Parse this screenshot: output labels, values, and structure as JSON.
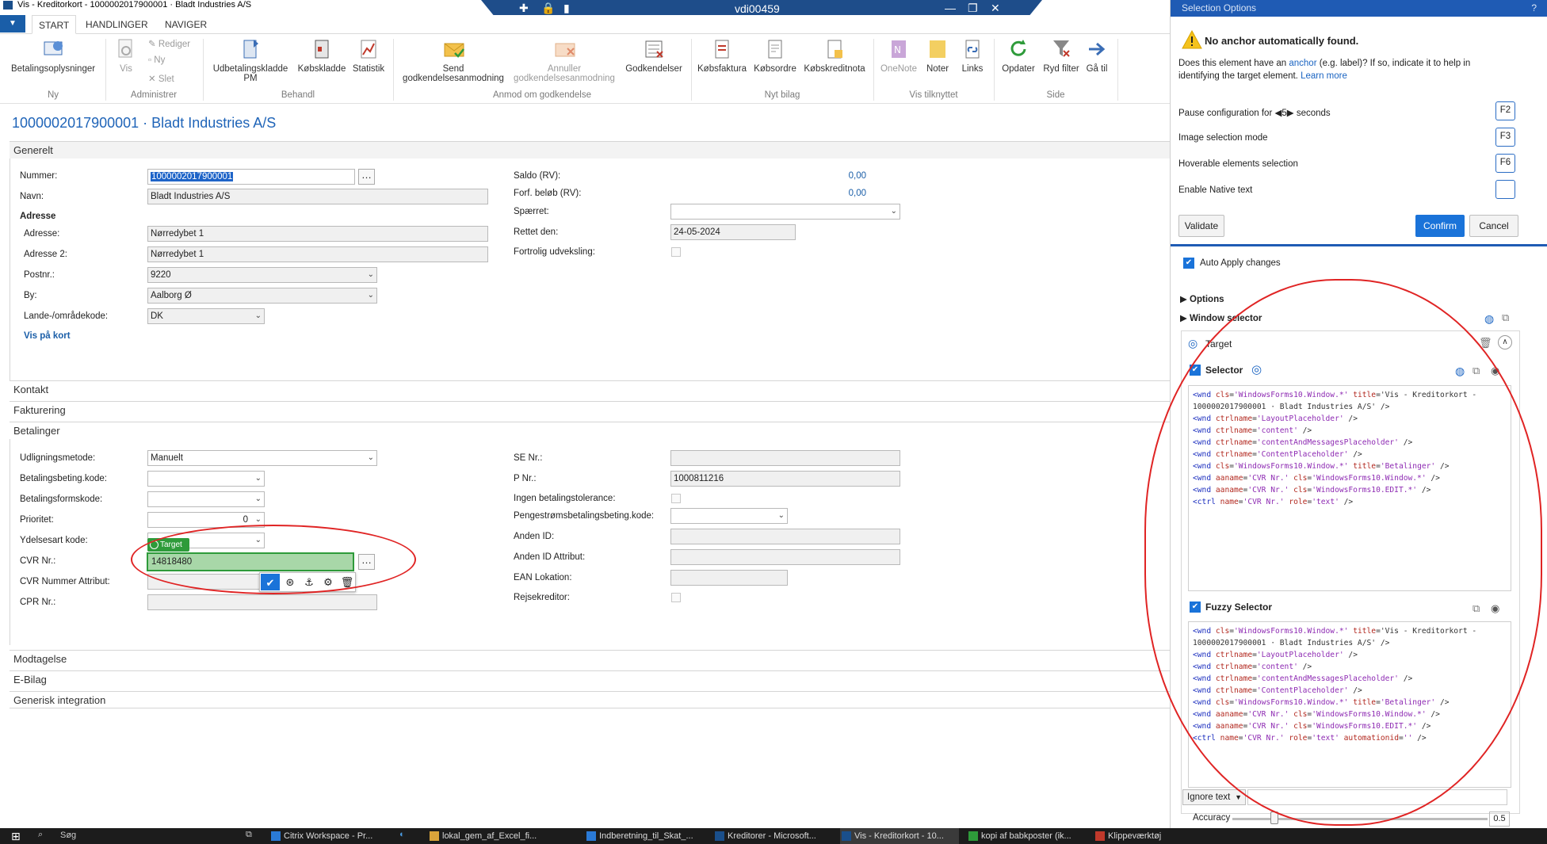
{
  "window": {
    "title": "Vis - Kreditorkort - 1000002017900001 · Bladt Industries A/S",
    "citrix_host": "vdi00459"
  },
  "ribbon_tabs": [
    {
      "label": "START"
    },
    {
      "label": "HANDLINGER"
    },
    {
      "label": "NAVIGER"
    }
  ],
  "ribbon": {
    "betalingsoplysninger": "Betalingsoplysninger",
    "vis": "Vis",
    "rediger": "Rediger",
    "ny": "Ny",
    "slet": "Slet",
    "udbetalingskladde_pm": "Udbetalingskladde PM",
    "kobskladde": "Købskladde",
    "statistik": "Statistik",
    "send_godkendelsesanmodning": "Send godkendelsesanmodning",
    "annuller_godkendelsesanmodning": "Annuller godkendelsesanmodning",
    "godkendelser": "Godkendelser",
    "kobsfaktura": "Købsfaktura",
    "kobsordre": "Købsordre",
    "kobskreditnota": "Købskreditnota",
    "onenote": "OneNote",
    "noter": "Noter",
    "links": "Links",
    "opdater": "Opdater",
    "ryd_filter": "Ryd filter",
    "ga_til": "Gå til",
    "groups": {
      "ny": "Ny",
      "administrer": "Administrer",
      "behandl": "Behandl",
      "anmod": "Anmod om godkendelse",
      "nyt_bilag": "Nyt bilag",
      "vis_tilknyttet": "Vis tilknyttet",
      "side": "Side"
    }
  },
  "page_title": "1000002017900001 · Bladt Industries A/S",
  "generelt": {
    "header": "Generelt",
    "nummer_label": "Nummer:",
    "nummer_value": "1000002017900001",
    "navn_label": "Navn:",
    "navn_value": "Bladt Industries A/S",
    "adresse_heading": "Adresse",
    "adresse_label": "Adresse:",
    "adresse_value": "Nørredybet 1",
    "adresse2_label": "Adresse 2:",
    "adresse2_value": "Nørredybet 1",
    "postnr_label": "Postnr.:",
    "postnr_value": "9220",
    "by_label": "By:",
    "by_value": "Aalborg Ø",
    "lande_label": "Lande-/områdekode:",
    "lande_value": "DK",
    "vis_paa_kort": "Vis på kort",
    "saldo_label": "Saldo (RV):",
    "saldo_value": "0,00",
    "forf_label": "Forf. beløb (RV):",
    "forf_value": "0,00",
    "spaerret_label": "Spærret:",
    "rettet_label": "Rettet den:",
    "rettet_value": "24-05-2024",
    "fortrolig_label": "Fortrolig udveksling:"
  },
  "collapsed_tabs": {
    "kontakt": "Kontakt",
    "fakturering": "Fakturering",
    "modtagelse": "Modtagelse",
    "ebilag": "E-Bilag",
    "generisk": "Generisk integration"
  },
  "betalinger": {
    "header": "Betalinger",
    "udligning_label": "Udligningsmetode:",
    "udligning_value": "Manuelt",
    "betingelse_label": "Betalingsbeting.kode:",
    "formkode_label": "Betalingsformskode:",
    "prioritet_label": "Prioritet:",
    "prioritet_value": "0",
    "ydelsesart_label": "Ydelsesart kode:",
    "cvr_label": "CVR Nr.:",
    "cvr_value": "14818480",
    "cvr_attr_label": "CVR Nummer Attribut:",
    "cpr_label": "CPR Nr.:",
    "se_label": "SE Nr.:",
    "p_label": "P Nr.:",
    "p_value": "1000811216",
    "ingen_label": "Ingen betalingstolerance:",
    "pengestrom_label": "Pengestrømsbetalingsbeting.kode:",
    "anden_id_label": "Anden ID:",
    "anden_id_attr_label": "Anden ID Attribut:",
    "ean_label": "EAN Lokation:",
    "rejse_label": "Rejsekreditor:"
  },
  "target_overlay": {
    "badge": "Target"
  },
  "selection_panel": {
    "title": "Selection Options",
    "help": "?",
    "warning_title": "No anchor automatically found.",
    "warning_body_1": "Does this element have an",
    "warning_link": "anchor",
    "warning_body_2": "(e.g. label)? If so, indicate it to help in",
    "warning_body_3": "identifying the target element.",
    "learn_more": "Learn more",
    "pause_label_1": "Pause configuration for",
    "pause_value": "5",
    "pause_label_2": "seconds",
    "pause_key": "F2",
    "image_mode": "Image selection mode",
    "image_key": "F3",
    "hoverable": "Hoverable elements selection",
    "hoverable_key": "F6",
    "native_text": "Enable Native text",
    "validate": "Validate",
    "confirm": "Confirm",
    "cancel": "Cancel",
    "auto_apply": "Auto Apply changes",
    "options": "Options",
    "window_selector": "Window selector",
    "target": "Target",
    "selector": "Selector",
    "fuzzy_selector": "Fuzzy Selector",
    "ignore_text": "Ignore text",
    "accuracy_label": "Accuracy",
    "accuracy_value": "0.5",
    "selector_lines": [
      "<wnd cls='WindowsForms10.Window.*' title='Vis - Kreditorkort -",
      "1000002017900001 · Bladt Industries A/S' />",
      "<wnd ctrlname='LayoutPlaceholder' />",
      "<wnd ctrlname='content' />",
      "<wnd ctrlname='contentAndMessagesPlaceholder' />",
      "<wnd ctrlname='ContentPlaceholder' />",
      "<wnd cls='WindowsForms10.Window.*' title='Betalinger' />",
      "<wnd aaname='CVR Nr.' cls='WindowsForms10.Window.*' />",
      "<wnd aaname='CVR Nr.' cls='WindowsForms10.EDIT.*' />",
      "<ctrl name='CVR Nr.' role='text' />"
    ],
    "fuzzy_lines": [
      "<wnd cls='WindowsForms10.Window.*' title='Vis - Kreditorkort -",
      "1000002017900001 · Bladt Industries A/S' />",
      "<wnd ctrlname='LayoutPlaceholder' />",
      "<wnd ctrlname='content' />",
      "<wnd ctrlname='contentAndMessagesPlaceholder' />",
      "<wnd ctrlname='ContentPlaceholder' />",
      "<wnd cls='WindowsForms10.Window.*' title='Betalinger' />",
      "<wnd aaname='CVR Nr.' cls='WindowsForms10.Window.*' />",
      "<wnd aaname='CVR Nr.' cls='WindowsForms10.EDIT.*' />",
      "<ctrl name='CVR Nr.' role='text' automationid='' />"
    ]
  },
  "taskbar": {
    "search": "Søg",
    "items": [
      {
        "label": "Citrix Workspace - Pr..."
      },
      {
        "label": "lokal_gem_af_Excel_fi..."
      },
      {
        "label": "Indberetning_til_Skat_..."
      },
      {
        "label": "Kreditorer - Microsoft..."
      },
      {
        "label": "Vis - Kreditorkort - 10..."
      },
      {
        "label": "kopi af babkposter (ik..."
      },
      {
        "label": "Klippeværktøj"
      }
    ]
  },
  "colors": {
    "accent": "#1a73d9",
    "title_blue": "#1f64b8",
    "panel_header": "#1f5bb4",
    "target_green": "#2e9b3a",
    "annotation_red": "#e02424"
  }
}
